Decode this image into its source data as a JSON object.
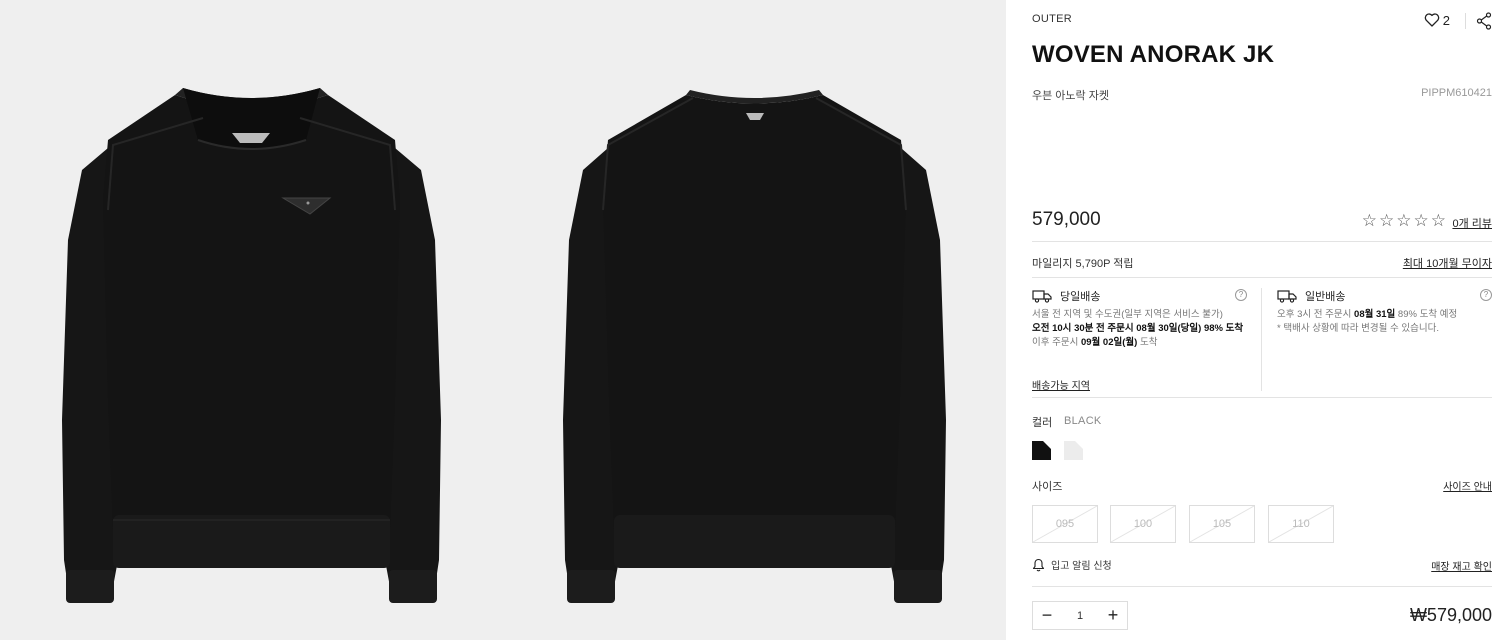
{
  "gallery": {
    "images": [
      {
        "name": "front-view",
        "alt": "front"
      },
      {
        "name": "back-view",
        "alt": "back"
      }
    ]
  },
  "product": {
    "category": "OUTER",
    "likes": "2",
    "title": "WOVEN ANORAK JK",
    "subtitle": "우븐 아노락 자켓",
    "code": "PIPPM610421",
    "price": "579,000",
    "review_link": "0개 리뷰",
    "rating": 0,
    "rating_max": 5
  },
  "benefits": {
    "mileage": "마일리지 5,790P 적립",
    "installment": "최대 10개월 무이자"
  },
  "shipping": {
    "same_day": {
      "title": "당일배송",
      "line1": "서울 전 지역 및 수도권(일부 지역은 서비스 불가)",
      "line2": "오전 10시 30분 전 주문시 08월 30일(당일) 98% 도착",
      "line3_prefix": "이후 주문시 ",
      "line3_date": "09월 02일(월)",
      "line3_suffix": " 도착",
      "area_link": "배송가능 지역"
    },
    "standard": {
      "title": "일반배송",
      "line1_prefix": "오후 3시 전 주문시 ",
      "line1_date": "08월 31일",
      "line1_suffix": " 89% 도착 예정",
      "line2": "* 택배사 상황에 따라 변경될 수 있습니다."
    }
  },
  "options": {
    "color_label": "컬러",
    "color_value": "BLACK",
    "colors": [
      "#111111",
      "#eeeeee"
    ],
    "size_label": "사이즈",
    "size_guide": "사이즈 안내",
    "sizes": [
      "095",
      "100",
      "105",
      "110"
    ],
    "restock": "입고 알림 신청",
    "stock_check": "매장 재고 확인"
  },
  "purchase": {
    "quantity": "1",
    "minus": "−",
    "plus": "+",
    "total": "₩579,000"
  }
}
